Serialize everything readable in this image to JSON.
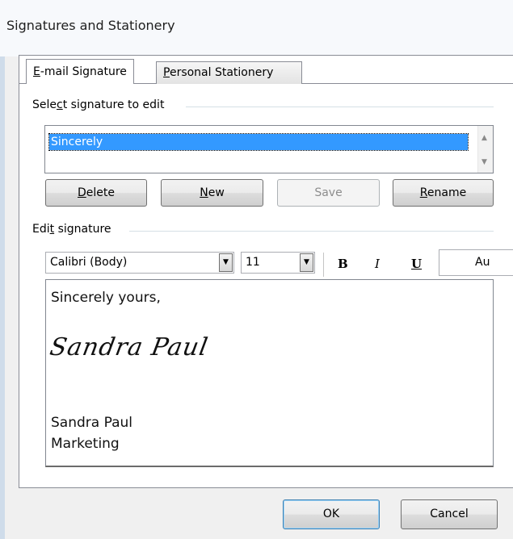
{
  "window": {
    "title": "Signatures and Stationery"
  },
  "tabs": [
    {
      "label_pre": "",
      "label_key": "E",
      "label_post": "-mail Signature"
    },
    {
      "label_pre": "",
      "label_key": "P",
      "label_post": "ersonal Stationery"
    }
  ],
  "select_group": {
    "pre": "Sele",
    "key": "c",
    "post": "t signature to edit"
  },
  "signature_list": {
    "items": [
      "Sincerely"
    ],
    "selected": "Sincerely"
  },
  "buttons": {
    "delete": {
      "pre": "",
      "key": "D",
      "post": "elete"
    },
    "new": {
      "pre": "",
      "key": "N",
      "post": "ew"
    },
    "save": "Save",
    "rename": {
      "pre": "",
      "key": "R",
      "post": "ename"
    }
  },
  "edit_group": {
    "pre": "Edi",
    "key": "t",
    "post": " signature"
  },
  "toolbar": {
    "font": "Calibri (Body)",
    "size": "11",
    "bold": "B",
    "italic": "I",
    "underline": "U",
    "color": "Au"
  },
  "signature_content": {
    "line1": "Sincerely yours,",
    "handwritten": "Sandra Paul",
    "name": "Sandra Paul",
    "department": "Marketing"
  },
  "footer": {
    "ok": "OK",
    "cancel": "Cancel"
  }
}
